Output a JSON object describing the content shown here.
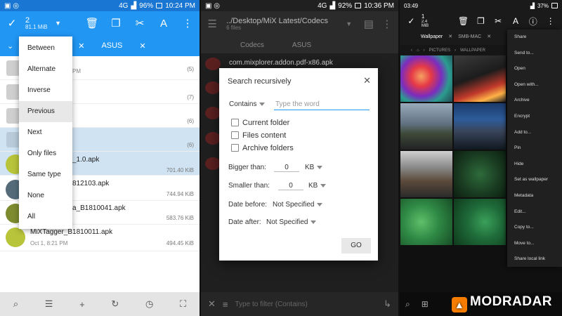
{
  "p1": {
    "status_time": "10:24 PM",
    "status_battery": "96%",
    "status_net": "4G",
    "selection_count": "2",
    "selection_size": "81.1 MiB",
    "tabs": [
      "ASUS"
    ],
    "menu": [
      "Between",
      "Alternate",
      "Inverse",
      "Previous",
      "Next",
      "Only files",
      "Same type",
      "None",
      "All"
    ],
    "rows": [
      {
        "name": "",
        "meta": "PM",
        "count": "(5)"
      },
      {
        "name": "",
        "meta": "",
        "count": "(7)"
      },
      {
        "name": "",
        "meta": "",
        "count": "(6)"
      },
      {
        "name": "",
        "meta": "",
        "count": "(6)"
      },
      {
        "name": "_1.0.apk",
        "meta": "",
        "count": "701.40 KiB"
      },
      {
        "name": "812103.apk",
        "meta": "",
        "count": "744.94 KiB"
      },
      {
        "name": "a_B1810041.apk",
        "meta": "",
        "count": "583.76 KiB"
      },
      {
        "name": "MiXTagger_B1810011.apk",
        "meta": "Oct 1, 8:21 PM",
        "count": "494.45 KiB"
      }
    ]
  },
  "p2": {
    "status_time": "10:36 PM",
    "status_battery": "92%",
    "status_net": "4G",
    "path": "../Desktop/MiX Latest/Codecs",
    "files_count": "6 files",
    "tabs": [
      "Codecs",
      "ASUS"
    ],
    "bg_rows": [
      "com.mixplorer.addon.pdf-x86.apk"
    ],
    "dialog": {
      "title": "Search recursively",
      "mode": "Contains",
      "placeholder": "Type the word",
      "opt1": "Current folder",
      "opt2": "Files content",
      "opt3": "Archive folders",
      "bigger_label": "Bigger than:",
      "bigger_val": "0",
      "bigger_unit": "KB",
      "smaller_label": "Smaller than:",
      "smaller_val": "0",
      "smaller_unit": "KB",
      "before_label": "Date before:",
      "before_val": "Not Specified",
      "after_label": "Date after:",
      "after_val": "Not Specified",
      "go": "GO"
    },
    "filter_placeholder": "Type to filter (Contains)"
  },
  "p3": {
    "status_time": "03:49",
    "status_battery": "37%",
    "selection_count": "1",
    "selection_size": "2.4 MiB",
    "tabs": [
      "Wallpaper",
      "SMB-MAC"
    ],
    "breadcrumb": [
      "PICTURES",
      "WALLPAPER"
    ],
    "menu": [
      "Share",
      "Send to...",
      "Open",
      "Open with...",
      "Archive",
      "Encrypt",
      "Add to...",
      "Pin",
      "Hide",
      "Set as wallpaper",
      "Metadata",
      "Edit...",
      "Copy to...",
      "Move to...",
      "Share local link"
    ]
  },
  "watermark": "MODRADAR",
  "colors": {
    "accent": "#2196f3",
    "accent_dark": "#1976d2",
    "logo": "#f57c00"
  }
}
